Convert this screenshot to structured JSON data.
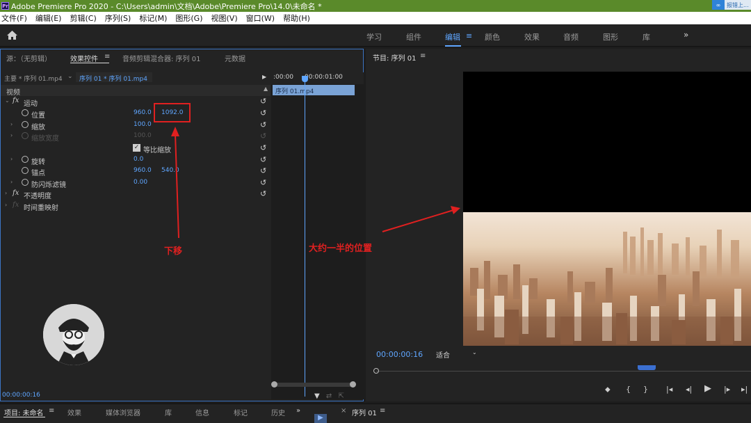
{
  "titlebar": {
    "title": "Adobe Premiere Pro 2020 - C:\\Users\\admin\\文档\\Adobe\\Premiere Pro\\14.0\\未命名 *",
    "badge": "报错上..."
  },
  "menu": [
    "文件(F)",
    "编辑(E)",
    "剪辑(C)",
    "序列(S)",
    "标记(M)",
    "图形(G)",
    "视图(V)",
    "窗口(W)",
    "帮助(H)"
  ],
  "workspaces": {
    "items": [
      "学习",
      "组件",
      "编辑",
      "颜色",
      "效果",
      "音频",
      "图形",
      "库"
    ],
    "active": "编辑",
    "more": "»"
  },
  "effect_panel": {
    "tabs": [
      "源：（无剪辑）",
      "效果控件",
      "音频剪辑混合器: 序列 01",
      "元数据"
    ],
    "tab_menu": "≡",
    "source_main": "主要 * 序列 01.mp4",
    "source_seq": "序列 01 * 序列 01.mp4",
    "section_video": "视频",
    "motion": "运动",
    "position_label": "位置",
    "position_x": "960.0",
    "position_y": "1092.0",
    "scale_label": "缩放",
    "scale_value": "100.0",
    "scale_width_label": "缩放宽度",
    "scale_width_value": "100.0",
    "uniform_scale": "等比缩放",
    "rotation_label": "旋转",
    "rotation_value": "0.0",
    "anchor_label": "锚点",
    "anchor_x": "960.0",
    "anchor_y": "540.0",
    "flicker_label": "防闪烁滤镜",
    "flicker_value": "0.00",
    "opacity": "不透明度",
    "time_remap": "时间重映射",
    "timecode": "00:00:00:16",
    "mini_timeline": {
      "t_start": ":00:00",
      "t_mark": "00:00:01:00",
      "clip": "序列 01.mp4"
    }
  },
  "annotations": {
    "move_down": "下移",
    "half_position": "大约一半的位置"
  },
  "program": {
    "title": "节目: 序列 01",
    "menu": "≡",
    "timecode": "00:00:00:16",
    "fit": "适合"
  },
  "bottom": {
    "tabs": [
      "项目: 未命名",
      "效果",
      "媒体浏览器",
      "库",
      "信息",
      "标记",
      "历史"
    ],
    "more": "»",
    "seq_tab": "序列 01"
  },
  "colors": {
    "titlebar": "#5a8a2a",
    "accent": "#5fa6ff",
    "annotation": "#e02020",
    "panel_border": "#3c74c4"
  }
}
